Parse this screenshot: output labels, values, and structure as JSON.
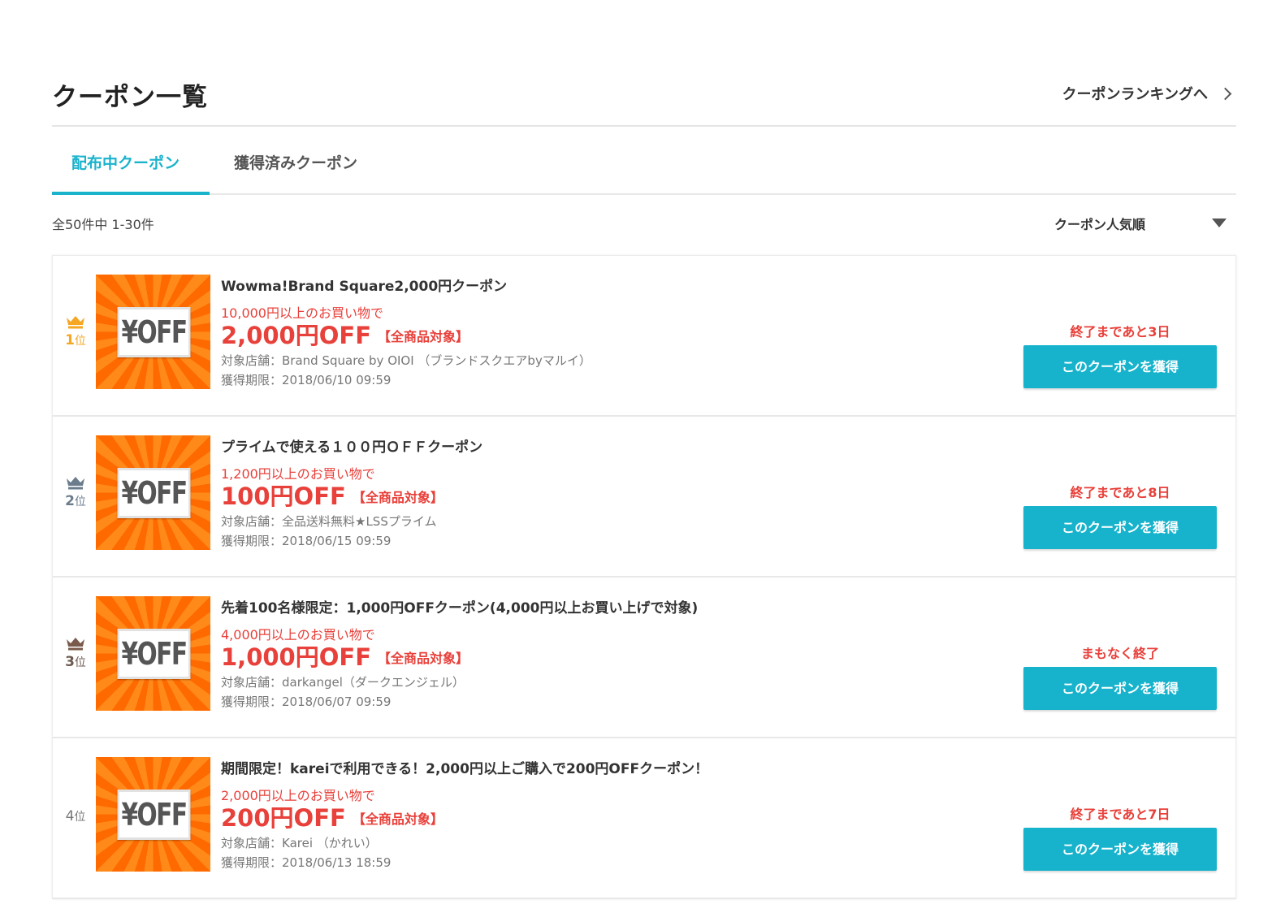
{
  "header": {
    "title": "クーポン一覧",
    "ranking_link": "クーポンランキングへ"
  },
  "tabs": [
    {
      "label": "配布中クーポン",
      "active": true
    },
    {
      "label": "獲得済みクーポン",
      "active": false
    }
  ],
  "result_count": "全50件中 1-30件",
  "sort": {
    "selected": "クーポン人気順"
  },
  "colors": {
    "accent": "#1ab3cc",
    "price_red": "#e8403a",
    "rank1": "#f5a623",
    "rank2": "#6b7c8c",
    "rank3": "#7a5a4a"
  },
  "coupon_image_text": "¥OFF",
  "coupons": [
    {
      "rank": "1",
      "rank_suffix": "位",
      "crown": "gold",
      "title": "Wowma!Brand Square2,000円クーポン",
      "condition": "10,000円以上のお買い物で",
      "discount": "2,000円OFF",
      "scope": "【全商品対象】",
      "shop": "対象店舗：Brand Square by OIOI （ブランドスクエアbyマルイ）",
      "deadline": "獲得期限：2018/06/10 09:59",
      "remaining": "終了まであと3日",
      "button": "このクーポンを獲得"
    },
    {
      "rank": "2",
      "rank_suffix": "位",
      "crown": "silver",
      "title": "プライムで使える１００円ＯＦＦクーポン",
      "condition": "1,200円以上のお買い物で",
      "discount": "100円OFF",
      "scope": "【全商品対象】",
      "shop": "対象店舗：全品送料無料★LSSプライム",
      "deadline": "獲得期限：2018/06/15 09:59",
      "remaining": "終了まであと8日",
      "button": "このクーポンを獲得"
    },
    {
      "rank": "3",
      "rank_suffix": "位",
      "crown": "bronze",
      "title": "先着100名様限定：1,000円OFFクーポン(4,000円以上お買い上げで対象)",
      "condition": "4,000円以上のお買い物で",
      "discount": "1,000円OFF",
      "scope": "【全商品対象】",
      "shop": "対象店舗：darkangel（ダークエンジェル）",
      "deadline": "獲得期限：2018/06/07 09:59",
      "remaining": "まもなく終了",
      "button": "このクーポンを獲得"
    },
    {
      "rank": "4",
      "rank_suffix": "位",
      "crown": "none",
      "title": "期間限定！kareiで利用できる！2,000円以上ご購入で200円OFFクーポン！",
      "condition": "2,000円以上のお買い物で",
      "discount": "200円OFF",
      "scope": "【全商品対象】",
      "shop": "対象店舗：Karei （かれい）",
      "deadline": "獲得期限：2018/06/13 18:59",
      "remaining": "終了まであと7日",
      "button": "このクーポンを獲得"
    }
  ]
}
